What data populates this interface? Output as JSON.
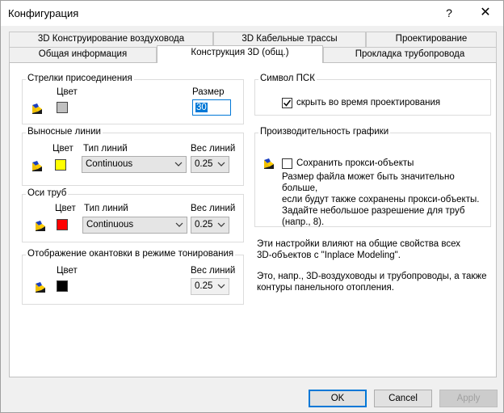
{
  "window": {
    "title": "Конфигурация",
    "help_label": "?",
    "close_label": "✕"
  },
  "tabs_row1": [
    {
      "label": "3D Конструирование воздуховода"
    },
    {
      "label": "3D Кабельные трассы"
    },
    {
      "label": "Проектирование"
    }
  ],
  "tabs_row2": [
    {
      "label": "Общая информация"
    },
    {
      "label": "Конструкция 3D (общ.)",
      "active": true
    },
    {
      "label": "Прокладка трубопровода"
    }
  ],
  "connection_arrows": {
    "title": "Стрелки присоединения",
    "color_label": "Цвет",
    "color": "#c0c0c0",
    "size_label": "Размер",
    "size_value": "30"
  },
  "leader_lines": {
    "title": "Выносные линии",
    "color_label": "Цвет",
    "color": "#ffff00",
    "linetype_label": "Тип линий",
    "linetype_value": "Continuous",
    "lineweight_label": "Вес линий",
    "lineweight_value": "0.25"
  },
  "pipe_axes": {
    "title": "Оси труб",
    "color_label": "Цвет",
    "color": "#ff0000",
    "linetype_label": "Тип линий",
    "linetype_value": "Continuous",
    "lineweight_label": "Вес линий",
    "lineweight_value": "0.25"
  },
  "edging": {
    "title": "Отображение окантовки в режиме тонирования",
    "color_label": "Цвет",
    "color": "#000000",
    "lineweight_label": "Вес линий",
    "lineweight_value": "0.25"
  },
  "ucs_symbol": {
    "title": "Символ ПСК",
    "hide_label": "скрыть во время проектирования",
    "hide_checked": true
  },
  "graphics_performance": {
    "title": "Производительность графики",
    "save_proxy_label": "Сохранить прокси-объекты",
    "save_proxy_checked": false,
    "description": [
      "Размер файла может быть значительно больше,",
      "если будут также сохранены прокси-объекты.",
      "Задайте небольшое разрешение для труб",
      "(напр., 8)."
    ]
  },
  "info_text_1": [
    "Эти настройки влияют на общие свойства всех",
    "3D-объектов с \"Inplace Modeling\"."
  ],
  "info_text_2": [
    "Это, напр., 3D-воздуховоды и трубопроводы, а также",
    "контуры панельного отопления."
  ],
  "buttons": {
    "ok": "OK",
    "cancel": "Cancel",
    "apply": "Apply"
  },
  "icons": {
    "color_picker": "color-palette-icon",
    "dropdown": "chevron-down-icon",
    "check": "checkmark-icon"
  }
}
